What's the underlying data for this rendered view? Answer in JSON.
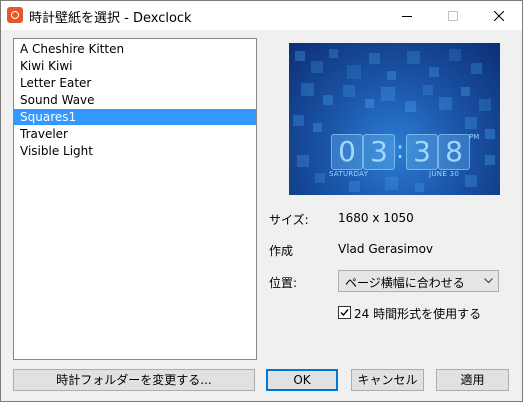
{
  "window": {
    "title": "時計壁紙を選択 - Dexclock"
  },
  "wallpapers": [
    {
      "label": "A Cheshire Kitten",
      "selected": false
    },
    {
      "label": "Kiwi Kiwi",
      "selected": false
    },
    {
      "label": "Letter Eater",
      "selected": false
    },
    {
      "label": "Sound Wave",
      "selected": false
    },
    {
      "label": "Squares1",
      "selected": true
    },
    {
      "label": "Traveler",
      "selected": false
    },
    {
      "label": "Visible Light",
      "selected": false
    }
  ],
  "preview": {
    "digits": [
      "0",
      "3",
      "3",
      "8"
    ],
    "separator": ":",
    "ampm": "PM",
    "day": "SATURDAY",
    "date": "JUNE 30"
  },
  "details": {
    "size_label": "サイズ:",
    "size_value": "1680 x 1050",
    "author_label": "作成",
    "author_value": "Vlad Gerasimov",
    "position_label": "位置:",
    "position_value": "ページ横幅に合わせる",
    "use_24h_label": "24 時間形式を使用する",
    "use_24h_checked": true
  },
  "buttons": {
    "change_folder": "時計フォルダーを変更する...",
    "ok": "OK",
    "cancel": "キャンセル",
    "apply": "適用"
  },
  "colors": {
    "selection": "#3399ff",
    "default_button_border": "#0078d7"
  }
}
